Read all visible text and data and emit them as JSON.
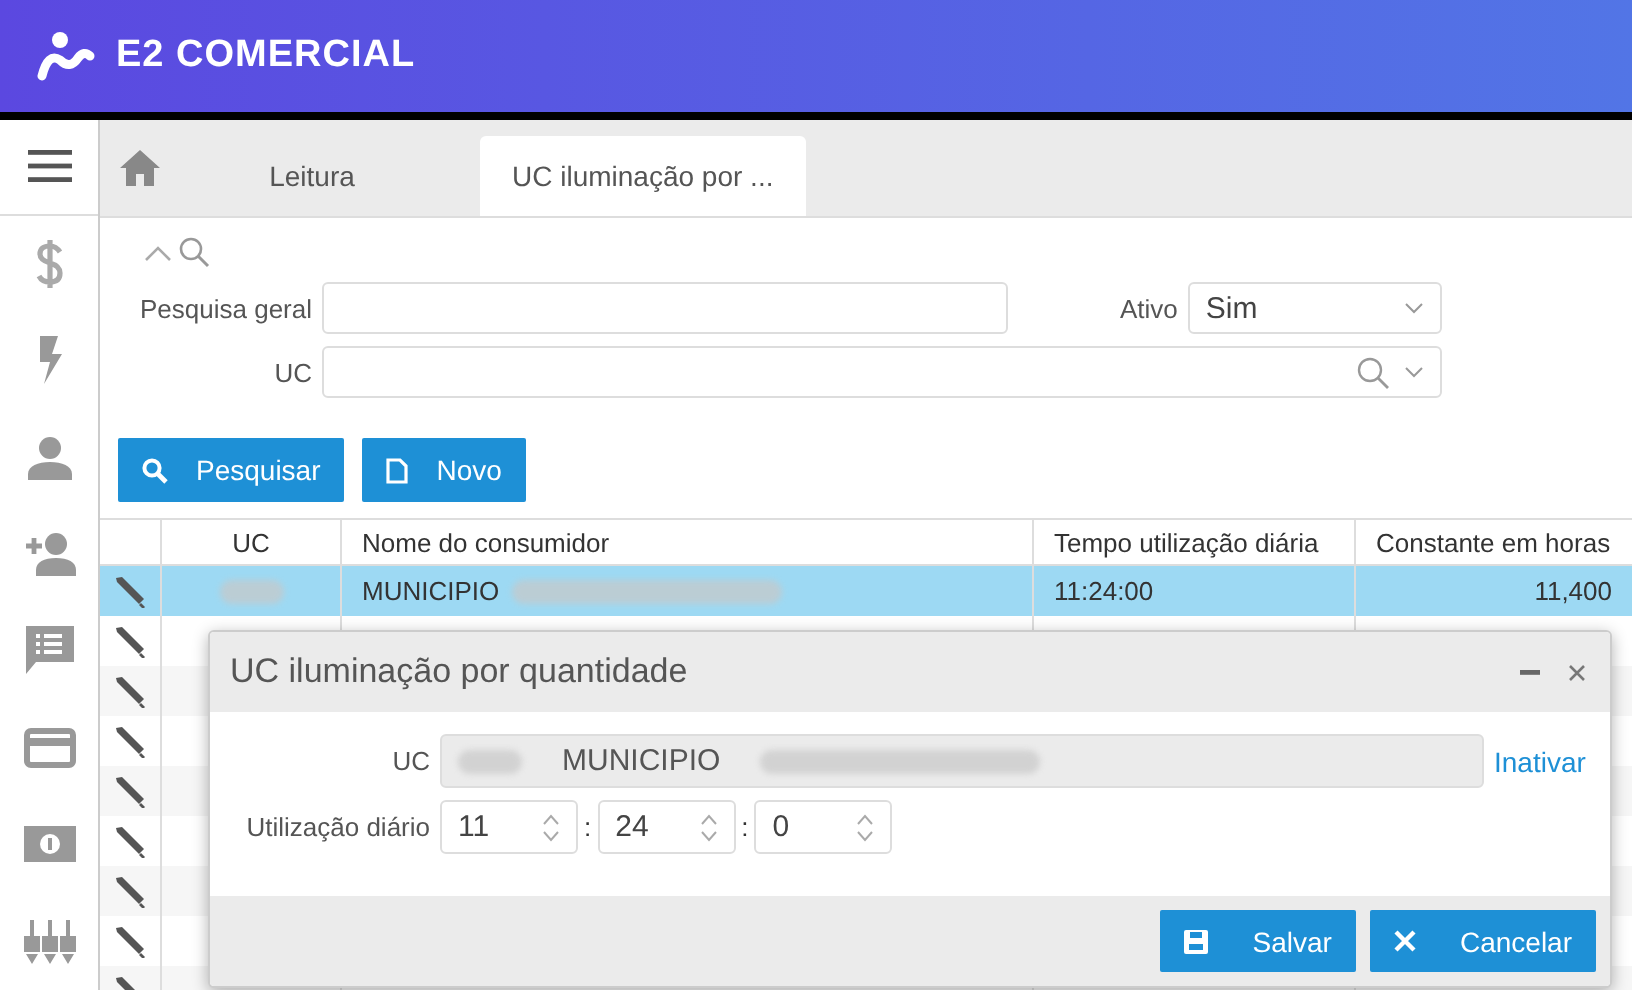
{
  "header": {
    "brand": "E2 COMERCIAL"
  },
  "sidebar": {
    "items": [
      {
        "kind": "dollar"
      },
      {
        "kind": "bolt"
      },
      {
        "kind": "person"
      },
      {
        "kind": "person-add"
      },
      {
        "kind": "comment-list"
      },
      {
        "kind": "card"
      },
      {
        "kind": "money"
      },
      {
        "kind": "plugs"
      }
    ]
  },
  "tabs": [
    {
      "label": "Leitura",
      "selected": false
    },
    {
      "label": "UC iluminação por ...",
      "selected": true
    }
  ],
  "filters": {
    "general_label": "Pesquisa geral",
    "ativo_label": "Ativo",
    "ativo_value": "Sim",
    "uc_label": "UC"
  },
  "buttons": [
    {
      "kind": "search",
      "label": "Pesquisar"
    },
    {
      "kind": "new",
      "label": "Novo"
    }
  ],
  "table": {
    "columns": [
      "UC",
      "Nome do consumidor",
      "Tempo utilização diária",
      "Constante em horas"
    ],
    "rows": [
      {
        "selected": true,
        "name": "MUNICIPIO",
        "time": "11:24:00",
        "constant": "11,400"
      },
      {
        "selected": false
      },
      {
        "selected": false
      },
      {
        "selected": false
      },
      {
        "selected": false
      },
      {
        "selected": false
      },
      {
        "selected": false
      },
      {
        "selected": false
      },
      {
        "selected": false
      }
    ]
  },
  "dialog": {
    "title": "UC iluminação por quantidade",
    "uc_label": "UC",
    "uc_value": "MUNICIPIO",
    "link": "Inativar",
    "time_label": "Utilização diário",
    "parts": [
      {
        "value": "11"
      },
      {
        "value": "24"
      },
      {
        "value": "0"
      }
    ],
    "separators": [
      ":",
      ":"
    ],
    "buttons": [
      {
        "kind": "save",
        "label": "Salvar"
      },
      {
        "kind": "cancel",
        "label": "Cancelar"
      }
    ]
  }
}
